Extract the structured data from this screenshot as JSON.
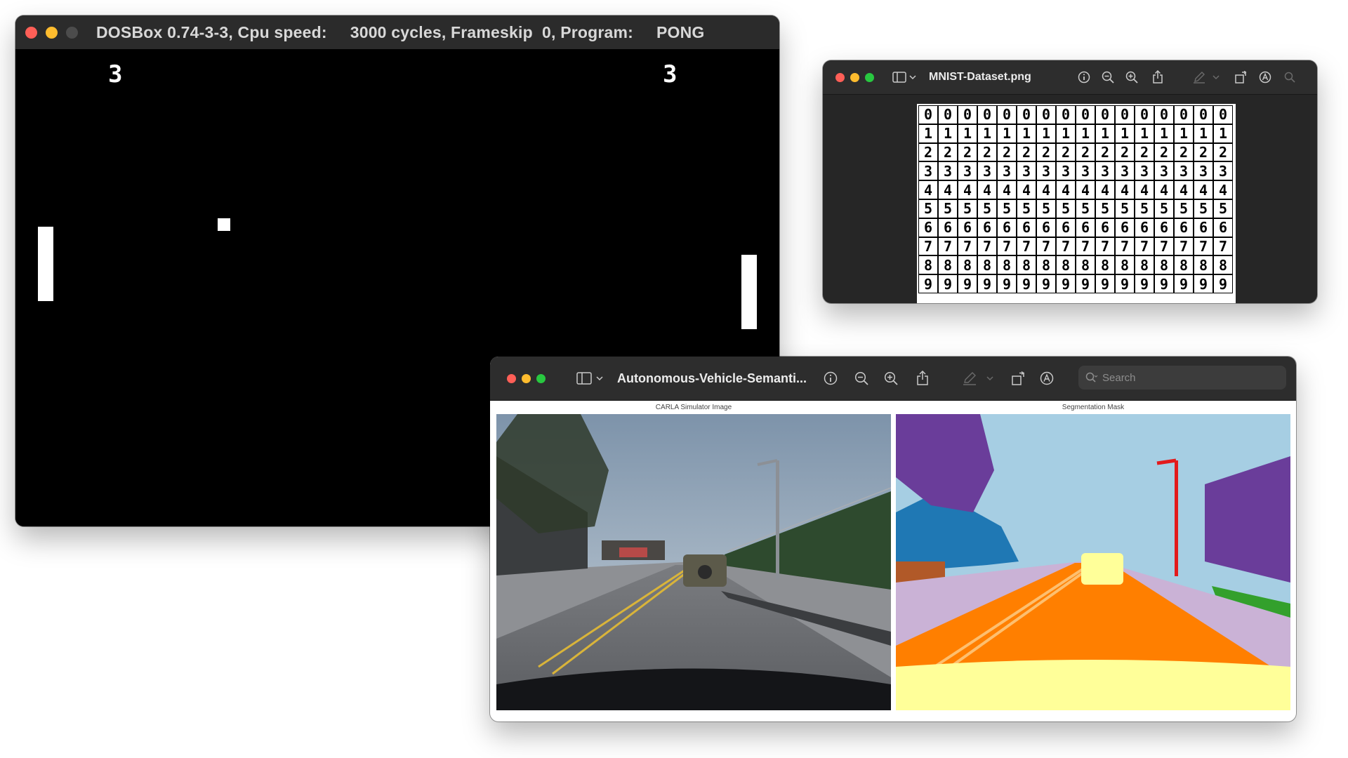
{
  "dosbox": {
    "title": "DOSBox 0.74-3-3, Cpu speed:     3000 cycles, Frameskip  0, Program:     PONG",
    "score_left": "3",
    "score_right": "3"
  },
  "mnist_window": {
    "title": "MNIST-Dataset.png",
    "digits": [
      "0",
      "1",
      "2",
      "3",
      "4",
      "5",
      "6",
      "7",
      "8",
      "9"
    ]
  },
  "seg_window": {
    "title": "Autonomous-Vehicle-Semanti...",
    "search_placeholder": "Search",
    "left_panel_title": "CARLA Simulator Image",
    "right_panel_title": "Segmentation Mask"
  },
  "colors": {
    "accent_red": "#ff5f57",
    "accent_yellow": "#febc2e",
    "accent_green": "#28c840",
    "mask_road": "#ff7f00",
    "mask_sky": "#a6cee3",
    "mask_vegetation": "#6a3d9a",
    "mask_sidewalk": "#cab2d6",
    "mask_hood": "#ffff99"
  }
}
